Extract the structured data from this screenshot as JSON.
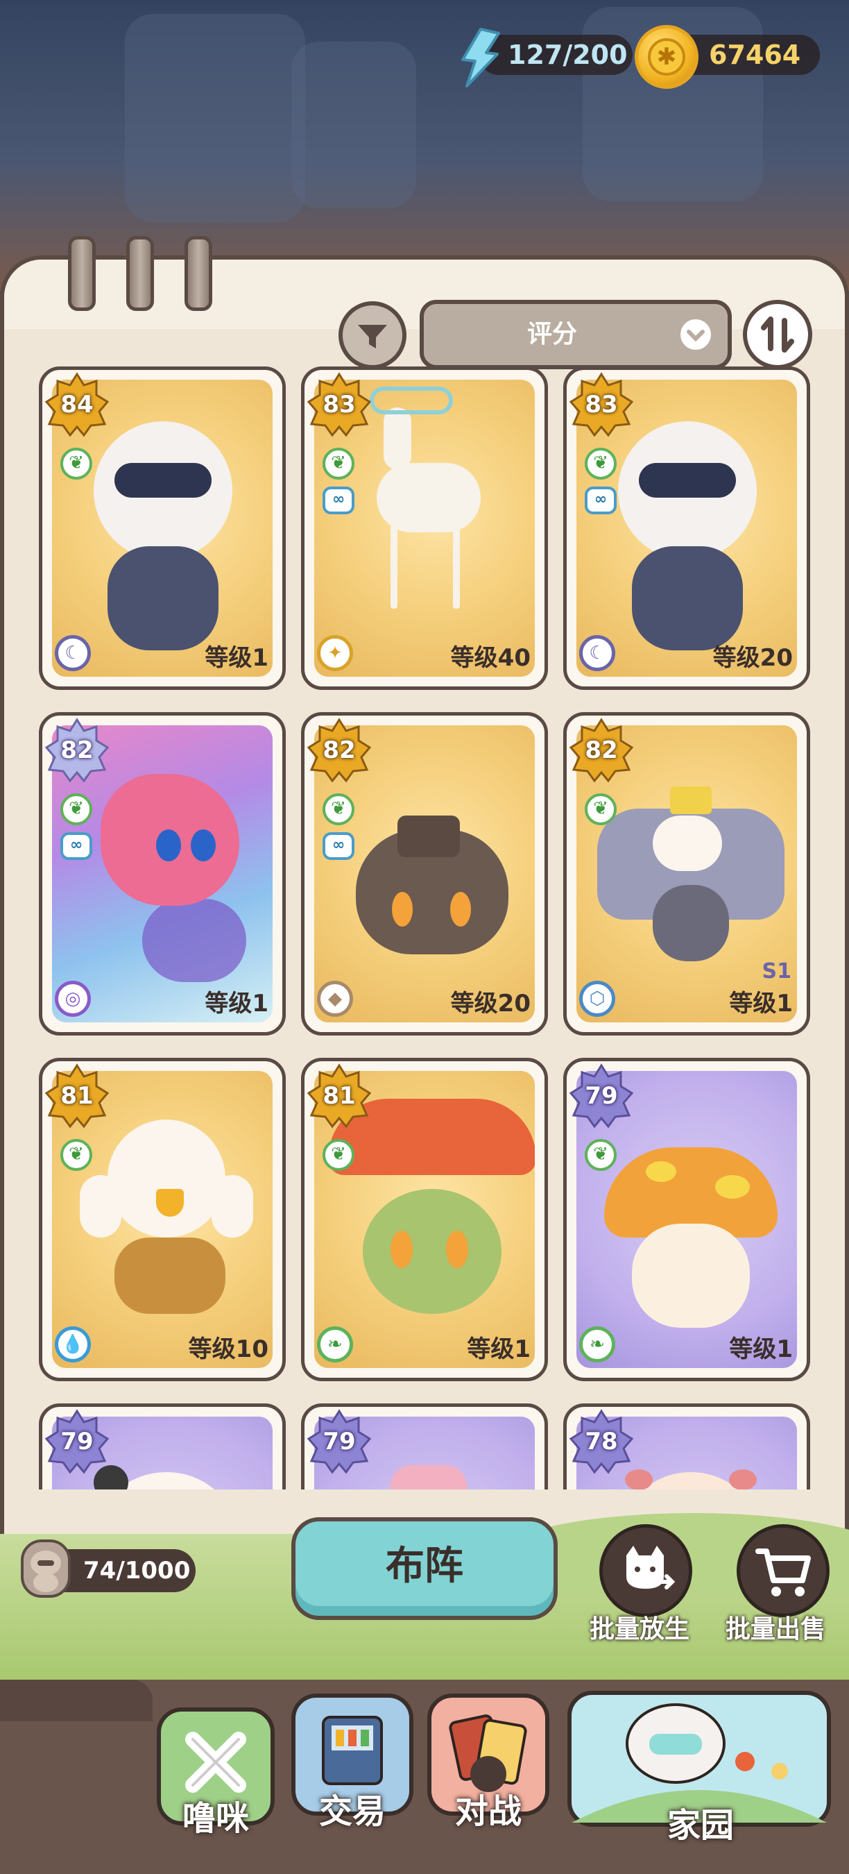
{
  "resources": {
    "energy": "127/200",
    "coins": "67464"
  },
  "sort": {
    "label": "评分"
  },
  "cards": [
    {
      "score": "84",
      "level": "等级1",
      "frame": "gold",
      "element": "moon",
      "tags": [
        "sprout"
      ]
    },
    {
      "score": "83",
      "level": "等级40",
      "frame": "gold",
      "element": "light",
      "tags": [
        "sprout",
        "link"
      ]
    },
    {
      "score": "83",
      "level": "等级20",
      "frame": "gold",
      "element": "moon",
      "tags": [
        "sprout",
        "link"
      ]
    },
    {
      "score": "82",
      "level": "等级1",
      "frame": "holo",
      "element": "psychic",
      "tags": [
        "sprout",
        "link"
      ]
    },
    {
      "score": "82",
      "level": "等级20",
      "frame": "gold",
      "element": "rock",
      "tags": [
        "sprout",
        "link"
      ]
    },
    {
      "score": "82",
      "level": "等级1",
      "frame": "gold",
      "element": "steel",
      "tags": [
        "sprout"
      ],
      "season": "S1"
    },
    {
      "score": "81",
      "level": "等级10",
      "frame": "gold",
      "element": "water",
      "tags": [
        "sprout"
      ]
    },
    {
      "score": "81",
      "level": "等级1",
      "frame": "gold",
      "element": "leaf",
      "tags": [
        "sprout"
      ]
    },
    {
      "score": "79",
      "level": "等级1",
      "frame": "purple",
      "element": "leaf",
      "tags": [
        "sprout"
      ]
    },
    {
      "score": "79",
      "level": "",
      "frame": "purple",
      "element": "",
      "tags": []
    },
    {
      "score": "79",
      "level": "",
      "frame": "purple",
      "element": "",
      "tags": []
    },
    {
      "score": "78",
      "level": "",
      "frame": "purple",
      "element": "",
      "tags": []
    }
  ],
  "storage": {
    "count": "74/1000"
  },
  "actions": {
    "deploy": "布阵",
    "batch_release": "批量放生",
    "batch_sell": "批量出售"
  },
  "nav": {
    "pets": "噜咪",
    "trade": "交易",
    "battle": "对战",
    "home": "家园"
  },
  "colors": {
    "panel": "#efe6d8",
    "outline": "#5a4a44",
    "accent_teal": "#82d3d4",
    "gold_frame": "#f5cf7c",
    "purple_frame": "#c1b0ec"
  }
}
